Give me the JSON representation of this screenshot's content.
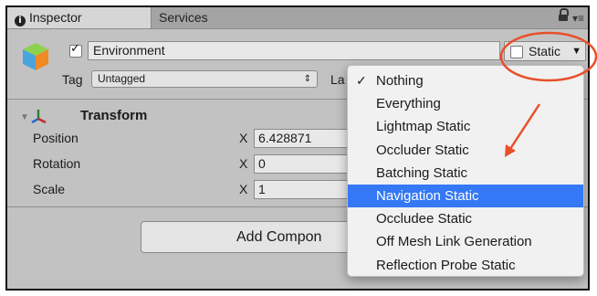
{
  "tabs": {
    "inspector": "Inspector",
    "services": "Services"
  },
  "header": {
    "name_value": "Environment",
    "static_label": "Static",
    "tag_label": "Tag",
    "tag_value": "Untagged",
    "layer_label_partial": "La"
  },
  "transform": {
    "title": "Transform",
    "rows": [
      {
        "label": "Position",
        "axis": "X",
        "value": "6.428871"
      },
      {
        "label": "Rotation",
        "axis": "X",
        "value": "0"
      },
      {
        "label": "Scale",
        "axis": "X",
        "value": "1"
      }
    ]
  },
  "add_component_label": "Add Compon",
  "static_menu": {
    "items": [
      "Nothing",
      "Everything",
      "Lightmap Static",
      "Occluder Static",
      "Batching Static",
      "Navigation Static",
      "Occludee Static",
      "Off Mesh Link Generation",
      "Reflection Probe Static"
    ],
    "checked_index": 0,
    "highlighted_index": 5
  },
  "colors": {
    "highlight": "#3478f6",
    "annotation": "#e8502a"
  },
  "icons": [
    "info-icon",
    "lock-icon",
    "menu-icon",
    "gameobject-cube-icon",
    "transform-icon",
    "checkmark-icon",
    "dropdown-arrow-icon"
  ]
}
